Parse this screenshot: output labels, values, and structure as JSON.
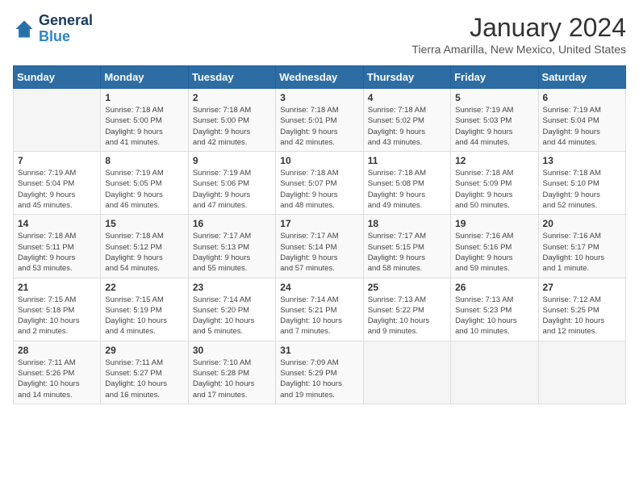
{
  "header": {
    "logo_line1": "General",
    "logo_line2": "Blue",
    "title": "January 2024",
    "subtitle": "Tierra Amarilla, New Mexico, United States"
  },
  "days_of_week": [
    "Sunday",
    "Monday",
    "Tuesday",
    "Wednesday",
    "Thursday",
    "Friday",
    "Saturday"
  ],
  "weeks": [
    [
      {
        "day": "",
        "info": ""
      },
      {
        "day": "1",
        "info": "Sunrise: 7:18 AM\nSunset: 5:00 PM\nDaylight: 9 hours\nand 41 minutes."
      },
      {
        "day": "2",
        "info": "Sunrise: 7:18 AM\nSunset: 5:00 PM\nDaylight: 9 hours\nand 42 minutes."
      },
      {
        "day": "3",
        "info": "Sunrise: 7:18 AM\nSunset: 5:01 PM\nDaylight: 9 hours\nand 42 minutes."
      },
      {
        "day": "4",
        "info": "Sunrise: 7:18 AM\nSunset: 5:02 PM\nDaylight: 9 hours\nand 43 minutes."
      },
      {
        "day": "5",
        "info": "Sunrise: 7:19 AM\nSunset: 5:03 PM\nDaylight: 9 hours\nand 44 minutes."
      },
      {
        "day": "6",
        "info": "Sunrise: 7:19 AM\nSunset: 5:04 PM\nDaylight: 9 hours\nand 44 minutes."
      }
    ],
    [
      {
        "day": "7",
        "info": "Sunrise: 7:19 AM\nSunset: 5:04 PM\nDaylight: 9 hours\nand 45 minutes."
      },
      {
        "day": "8",
        "info": "Sunrise: 7:19 AM\nSunset: 5:05 PM\nDaylight: 9 hours\nand 46 minutes."
      },
      {
        "day": "9",
        "info": "Sunrise: 7:19 AM\nSunset: 5:06 PM\nDaylight: 9 hours\nand 47 minutes."
      },
      {
        "day": "10",
        "info": "Sunrise: 7:18 AM\nSunset: 5:07 PM\nDaylight: 9 hours\nand 48 minutes."
      },
      {
        "day": "11",
        "info": "Sunrise: 7:18 AM\nSunset: 5:08 PM\nDaylight: 9 hours\nand 49 minutes."
      },
      {
        "day": "12",
        "info": "Sunrise: 7:18 AM\nSunset: 5:09 PM\nDaylight: 9 hours\nand 50 minutes."
      },
      {
        "day": "13",
        "info": "Sunrise: 7:18 AM\nSunset: 5:10 PM\nDaylight: 9 hours\nand 52 minutes."
      }
    ],
    [
      {
        "day": "14",
        "info": "Sunrise: 7:18 AM\nSunset: 5:11 PM\nDaylight: 9 hours\nand 53 minutes."
      },
      {
        "day": "15",
        "info": "Sunrise: 7:18 AM\nSunset: 5:12 PM\nDaylight: 9 hours\nand 54 minutes."
      },
      {
        "day": "16",
        "info": "Sunrise: 7:17 AM\nSunset: 5:13 PM\nDaylight: 9 hours\nand 55 minutes."
      },
      {
        "day": "17",
        "info": "Sunrise: 7:17 AM\nSunset: 5:14 PM\nDaylight: 9 hours\nand 57 minutes."
      },
      {
        "day": "18",
        "info": "Sunrise: 7:17 AM\nSunset: 5:15 PM\nDaylight: 9 hours\nand 58 minutes."
      },
      {
        "day": "19",
        "info": "Sunrise: 7:16 AM\nSunset: 5:16 PM\nDaylight: 9 hours\nand 59 minutes."
      },
      {
        "day": "20",
        "info": "Sunrise: 7:16 AM\nSunset: 5:17 PM\nDaylight: 10 hours\nand 1 minute."
      }
    ],
    [
      {
        "day": "21",
        "info": "Sunrise: 7:15 AM\nSunset: 5:18 PM\nDaylight: 10 hours\nand 2 minutes."
      },
      {
        "day": "22",
        "info": "Sunrise: 7:15 AM\nSunset: 5:19 PM\nDaylight: 10 hours\nand 4 minutes."
      },
      {
        "day": "23",
        "info": "Sunrise: 7:14 AM\nSunset: 5:20 PM\nDaylight: 10 hours\nand 5 minutes."
      },
      {
        "day": "24",
        "info": "Sunrise: 7:14 AM\nSunset: 5:21 PM\nDaylight: 10 hours\nand 7 minutes."
      },
      {
        "day": "25",
        "info": "Sunrise: 7:13 AM\nSunset: 5:22 PM\nDaylight: 10 hours\nand 9 minutes."
      },
      {
        "day": "26",
        "info": "Sunrise: 7:13 AM\nSunset: 5:23 PM\nDaylight: 10 hours\nand 10 minutes."
      },
      {
        "day": "27",
        "info": "Sunrise: 7:12 AM\nSunset: 5:25 PM\nDaylight: 10 hours\nand 12 minutes."
      }
    ],
    [
      {
        "day": "28",
        "info": "Sunrise: 7:11 AM\nSunset: 5:26 PM\nDaylight: 10 hours\nand 14 minutes."
      },
      {
        "day": "29",
        "info": "Sunrise: 7:11 AM\nSunset: 5:27 PM\nDaylight: 10 hours\nand 16 minutes."
      },
      {
        "day": "30",
        "info": "Sunrise: 7:10 AM\nSunset: 5:28 PM\nDaylight: 10 hours\nand 17 minutes."
      },
      {
        "day": "31",
        "info": "Sunrise: 7:09 AM\nSunset: 5:29 PM\nDaylight: 10 hours\nand 19 minutes."
      },
      {
        "day": "",
        "info": ""
      },
      {
        "day": "",
        "info": ""
      },
      {
        "day": "",
        "info": ""
      }
    ]
  ]
}
